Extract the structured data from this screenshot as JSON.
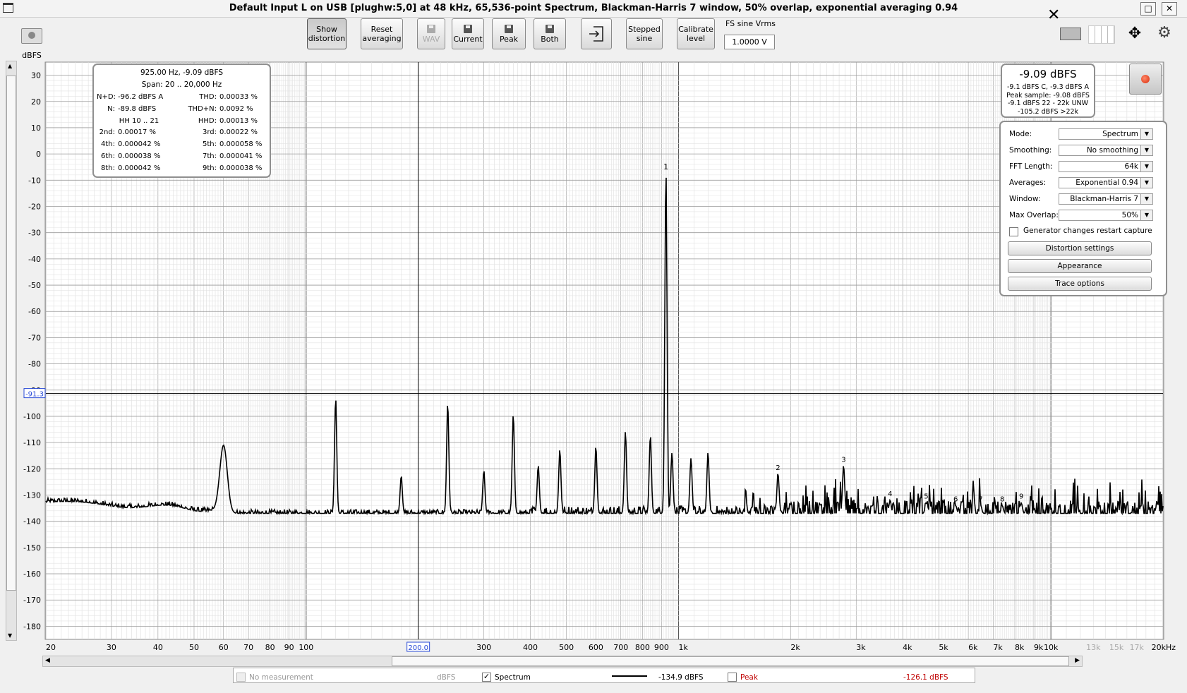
{
  "window": {
    "title": "Default Input L on USB [plughw:5,0] at 48 kHz, 65,536-point Spectrum, Blackman-Harris 7 window, 50% overlap, exponential averaging 0.94",
    "maximize_glyph": "□",
    "close_glyph": "✕",
    "app_icon": "window-icon"
  },
  "toolbar": {
    "show_distortion": [
      "Show",
      "distortion"
    ],
    "reset_averaging": [
      "Reset",
      "averaging"
    ],
    "wav": "WAV",
    "current": "Current",
    "peak": "Peak",
    "both": "Both",
    "stepped_sine": [
      "Stepped",
      "sine"
    ],
    "calibrate_level": [
      "Calibrate",
      "level"
    ],
    "fs_sine_label": "FS sine Vrms",
    "fs_sine_value": "1.0000 V",
    "close_overlay": "✕"
  },
  "axis": {
    "y_unit": "dBFS",
    "y_ticks": [
      "30",
      "20",
      "10",
      "0",
      "-10",
      "-20",
      "-30",
      "-40",
      "-50",
      "-60",
      "-70",
      "-80",
      "-90",
      "-100",
      "-110",
      "-120",
      "-130",
      "-140",
      "-150",
      "-160",
      "-170",
      "-180"
    ],
    "cursor_y_label": "-91.3",
    "cursor_x_label": "200.0",
    "x_ticks": [
      "20",
      "30",
      "40",
      "50",
      "60",
      "70",
      "80",
      "90",
      "100",
      "300",
      "400",
      "500",
      "600",
      "700",
      "800",
      "900",
      "1k",
      "2k",
      "3k",
      "4k",
      "5k",
      "6k",
      "7k",
      "8k",
      "9k",
      "10k",
      "13k",
      "15k",
      "17k",
      "20kHz"
    ],
    "x_ticks_grey": [
      "13k",
      "15k",
      "17k"
    ]
  },
  "distortion": {
    "header": "925.00 Hz, -9.09 dBFS",
    "span": "Span: 20 .. 20,000 Hz",
    "rows": [
      [
        "N+D:",
        "-96.2 dBFS A",
        "THD:",
        "0.00033 %"
      ],
      [
        "N:",
        "-89.8 dBFS",
        "THD+N:",
        "0.0092 %"
      ],
      [
        "",
        "HH 10 .. 21",
        "HHD:",
        "0.00013 %"
      ],
      [
        "2nd:",
        "0.00017 %",
        "3rd:",
        "0.00022 %"
      ],
      [
        "4th:",
        "0.000042 %",
        "5th:",
        "0.000058 %"
      ],
      [
        "6th:",
        "0.000038 %",
        "7th:",
        "0.000041 %"
      ],
      [
        "8th:",
        "0.000042 %",
        "9th:",
        "0.000038 %"
      ]
    ]
  },
  "level": {
    "main": "-9.09 dBFS",
    "lines": [
      "-9.1 dBFS C, -9.3 dBFS A",
      "Peak sample: -9.08 dBFS",
      "-9.1 dBFS 22 - 22k UNW",
      "-105.2 dBFS >22k"
    ]
  },
  "controls": {
    "mode_label": "Mode:",
    "mode_value": "Spectrum",
    "smoothing_label": "Smoothing:",
    "smoothing_value": "No  smoothing",
    "fft_label": "FFT Length:",
    "fft_value": "64k",
    "averages_label": "Averages:",
    "averages_value": "Exponential 0.94",
    "window_label": "Window:",
    "window_value": "Blackman-Harris 7",
    "overlap_label": "Max Overlap:",
    "overlap_value": "50%",
    "generator_checkbox": "Generator changes restart capture",
    "distortion_settings": "Distortion settings",
    "appearance": "Appearance",
    "trace_options": "Trace options"
  },
  "legend": {
    "no_measurement": "No measurement",
    "unit": "dBFS",
    "spectrum": "Spectrum",
    "spectrum_value": "-134.9 dBFS",
    "peak": "Peak",
    "peak_value": "-126.1 dBFS",
    "spectrum_checked": "✓",
    "peak_color": "#c00000"
  },
  "chart_data": {
    "type": "line",
    "x_scale": "log",
    "xlim": [
      20,
      20000
    ],
    "ylim": [
      -185,
      35
    ],
    "ylabel": "dBFS",
    "grid": true,
    "cursor": {
      "x": 200.0,
      "y": -91.3
    },
    "noise_floor": -137,
    "fundamental": {
      "freq": 925,
      "level": -9.09,
      "label": "1"
    },
    "peaks": [
      {
        "freq": 60,
        "level": -111
      },
      {
        "freq": 120,
        "level": -94
      },
      {
        "freq": 180,
        "level": -123
      },
      {
        "freq": 240,
        "level": -96
      },
      {
        "freq": 300,
        "level": -121
      },
      {
        "freq": 360,
        "level": -100
      },
      {
        "freq": 420,
        "level": -119
      },
      {
        "freq": 480,
        "level": -113
      },
      {
        "freq": 600,
        "level": -112
      },
      {
        "freq": 720,
        "level": -106
      },
      {
        "freq": 840,
        "level": -108
      },
      {
        "freq": 960,
        "level": -114
      },
      {
        "freq": 1080,
        "level": -116
      },
      {
        "freq": 1200,
        "level": -114
      }
    ],
    "harmonic_markers": [
      {
        "label": "2",
        "freq": 1850,
        "level": -122
      },
      {
        "label": "3",
        "freq": 2775,
        "level": -119
      },
      {
        "label": "4",
        "freq": 3700,
        "level": -132
      },
      {
        "label": "5",
        "freq": 4625,
        "level": -133
      },
      {
        "label": "6",
        "freq": 5550,
        "level": -134
      },
      {
        "label": "7",
        "freq": 6475,
        "level": -134
      },
      {
        "label": "8",
        "freq": 7400,
        "level": -134
      },
      {
        "label": "9",
        "freq": 8325,
        "level": -133
      }
    ]
  }
}
